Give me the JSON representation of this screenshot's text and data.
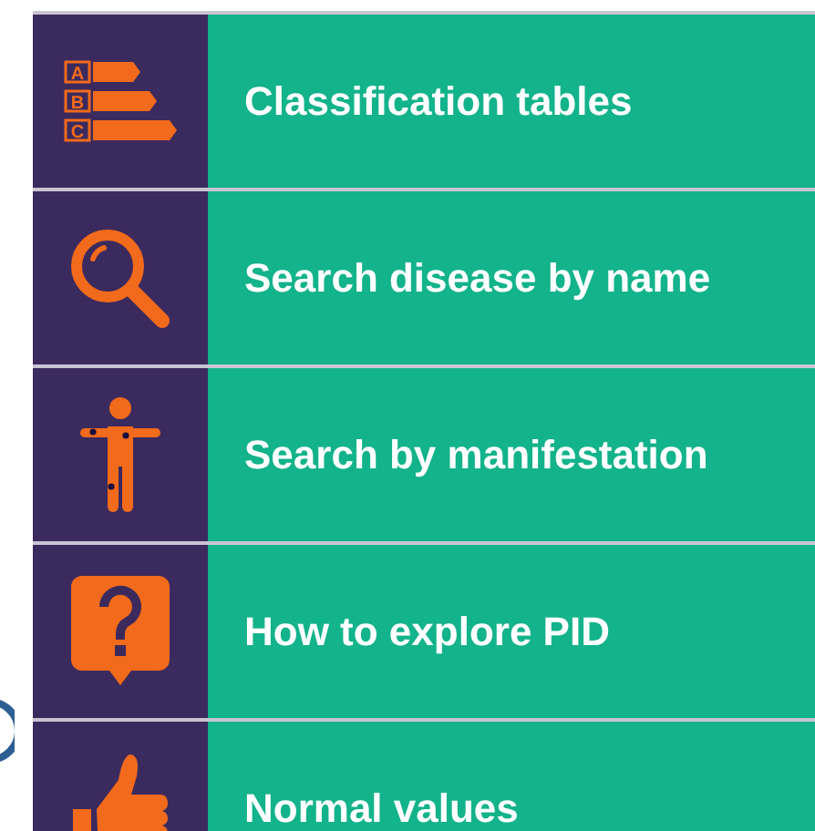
{
  "menu": [
    {
      "kind": "grades",
      "label": "Classification tables",
      "icon_letters": [
        "A",
        "B",
        "C"
      ]
    },
    {
      "kind": "search",
      "label": "Search disease by name"
    },
    {
      "kind": "body",
      "label": "Search by manifestation"
    },
    {
      "kind": "question",
      "label": "How to explore PID"
    },
    {
      "kind": "thumb",
      "label": "Normal values"
    }
  ]
}
